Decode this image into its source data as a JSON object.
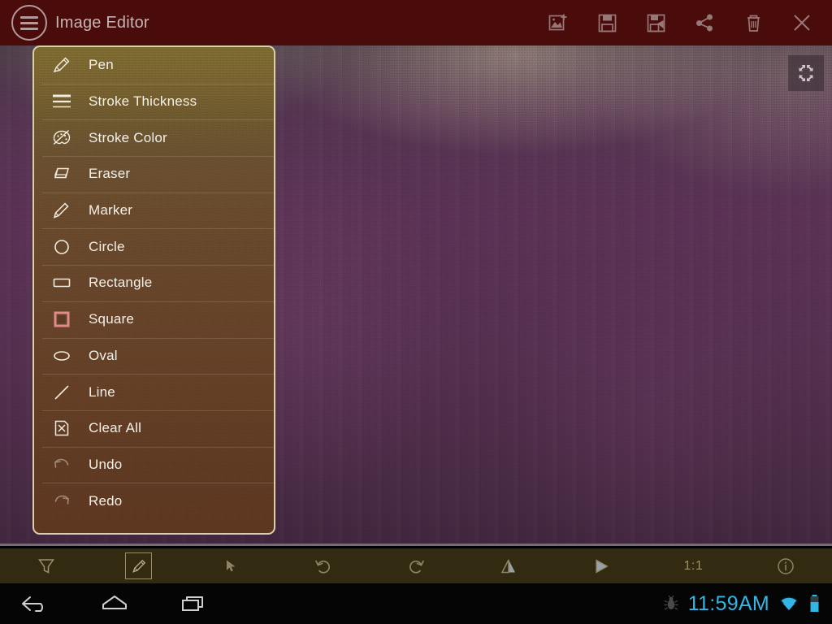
{
  "titlebar": {
    "menu_icon": "hamburger-icon",
    "title": "Image Editor",
    "actions": [
      {
        "name": "add-image-button",
        "icon": "add-image-icon",
        "label": "Add Image"
      },
      {
        "name": "save-button",
        "icon": "save-icon",
        "label": "Save"
      },
      {
        "name": "save-as-button",
        "icon": "save-as-icon",
        "label": "Save As"
      },
      {
        "name": "share-button",
        "icon": "share-icon",
        "label": "Share"
      },
      {
        "name": "delete-button",
        "icon": "trash-icon",
        "label": "Delete"
      },
      {
        "name": "close-button",
        "icon": "close-icon",
        "label": "Close"
      }
    ]
  },
  "canvas": {
    "fullscreen_icon": "fullscreen-expand-icon",
    "background_color": "#563051",
    "highlight_color": "#bdac98"
  },
  "menu": {
    "border_color": "#d9cfae",
    "selected_color": "#e08a8a",
    "items": [
      {
        "label": "Pen",
        "icon": "pen-icon",
        "state": "normal"
      },
      {
        "label": "Stroke Thickness",
        "icon": "lines-icon",
        "state": "normal"
      },
      {
        "label": "Stroke Color",
        "icon": "palette-icon",
        "state": "normal"
      },
      {
        "label": "Eraser",
        "icon": "eraser-icon",
        "state": "normal"
      },
      {
        "label": "Marker",
        "icon": "marker-icon",
        "state": "normal"
      },
      {
        "label": "Circle",
        "icon": "circle-icon",
        "state": "normal"
      },
      {
        "label": "Rectangle",
        "icon": "rectangle-icon",
        "state": "normal"
      },
      {
        "label": "Square",
        "icon": "square-icon",
        "state": "selected"
      },
      {
        "label": "Oval",
        "icon": "oval-icon",
        "state": "normal"
      },
      {
        "label": "Line",
        "icon": "line-icon",
        "state": "normal"
      },
      {
        "label": "Clear All",
        "icon": "clear-all-icon",
        "state": "normal"
      },
      {
        "label": "Undo",
        "icon": "undo-icon",
        "state": "disabled"
      },
      {
        "label": "Redo",
        "icon": "redo-icon",
        "state": "disabled"
      }
    ]
  },
  "bottombar": {
    "items": [
      {
        "name": "filter-button",
        "icon": "filter-icon",
        "label": "",
        "selected": false
      },
      {
        "name": "draw-tool-button",
        "icon": "pencil-icon",
        "label": "",
        "selected": true
      },
      {
        "name": "select-button",
        "icon": "cursor-icon",
        "label": "",
        "selected": false
      },
      {
        "name": "rotate-left-button",
        "icon": "rotate-ccw-icon",
        "label": "",
        "selected": false
      },
      {
        "name": "rotate-right-button",
        "icon": "rotate-cw-icon",
        "label": "",
        "selected": false
      },
      {
        "name": "flip-button",
        "icon": "flip-icon",
        "label": "",
        "selected": false
      },
      {
        "name": "play-button",
        "icon": "play-icon",
        "label": "",
        "selected": false
      },
      {
        "name": "zoom-reset-button",
        "icon": "",
        "label": "1:1",
        "selected": false
      },
      {
        "name": "info-button",
        "icon": "info-icon",
        "label": "",
        "selected": false
      }
    ]
  },
  "statusbar": {
    "nav": [
      {
        "name": "nav-back-button",
        "icon": "back-arrow-icon"
      },
      {
        "name": "nav-home-button",
        "icon": "home-icon"
      },
      {
        "name": "nav-recents-button",
        "icon": "recents-icon"
      }
    ],
    "bug_icon": "bug-icon",
    "time": "11:59AM",
    "time_color": "#33b5e5",
    "wifi_icon": "wifi-icon",
    "battery_icon": "battery-icon"
  }
}
